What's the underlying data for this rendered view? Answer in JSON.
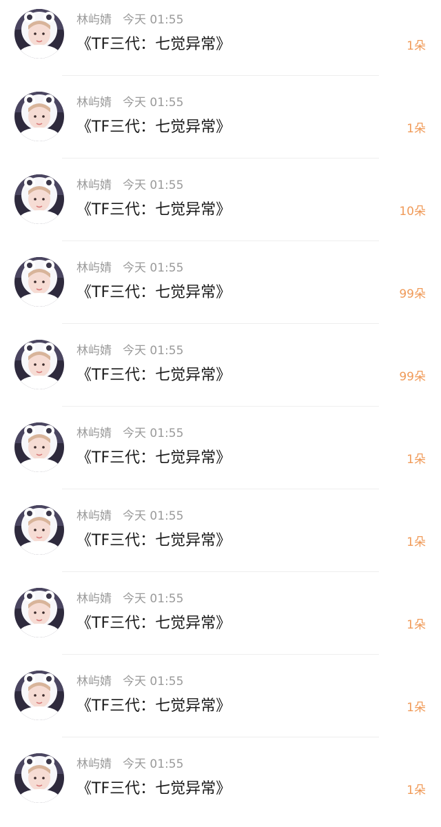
{
  "colors": {
    "background": "#ffffff",
    "name_text": "#9a9a9a",
    "message_text": "#1a1a1a",
    "gift_text": "#f09a58",
    "divider": "#eeeeee"
  },
  "messages": [
    {
      "user": "林屿婧",
      "time": "今天 01:55",
      "text": "《TF三代：七觉异常》",
      "gift": "1朵"
    },
    {
      "user": "林屿婧",
      "time": "今天 01:55",
      "text": "《TF三代：七觉异常》",
      "gift": "1朵"
    },
    {
      "user": "林屿婧",
      "time": "今天 01:55",
      "text": "《TF三代：七觉异常》",
      "gift": "10朵"
    },
    {
      "user": "林屿婧",
      "time": "今天 01:55",
      "text": "《TF三代：七觉异常》",
      "gift": "99朵"
    },
    {
      "user": "林屿婧",
      "time": "今天 01:55",
      "text": "《TF三代：七觉异常》",
      "gift": "99朵"
    },
    {
      "user": "林屿婧",
      "time": "今天 01:55",
      "text": "《TF三代：七觉异常》",
      "gift": "1朵"
    },
    {
      "user": "林屿婧",
      "time": "今天 01:55",
      "text": "《TF三代：七觉异常》",
      "gift": "1朵"
    },
    {
      "user": "林屿婧",
      "time": "今天 01:55",
      "text": "《TF三代：七觉异常》",
      "gift": "1朵"
    },
    {
      "user": "林屿婧",
      "time": "今天 01:55",
      "text": "《TF三代：七觉异常》",
      "gift": "1朵"
    },
    {
      "user": "林屿婧",
      "time": "今天 01:55",
      "text": "《TF三代：七觉异常》",
      "gift": "1朵"
    }
  ]
}
